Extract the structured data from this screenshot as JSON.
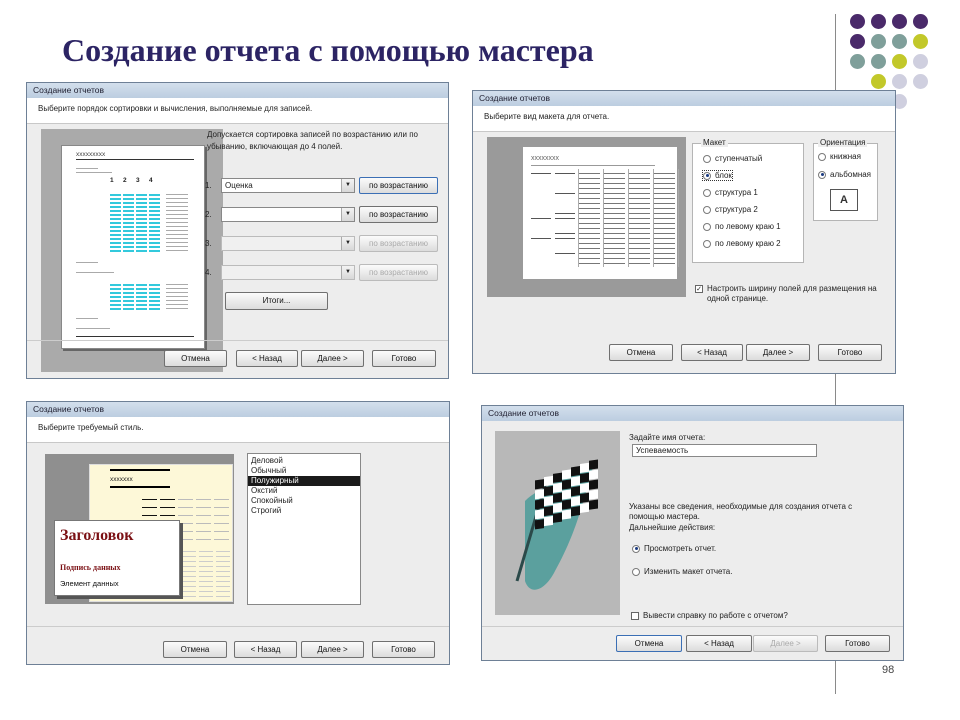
{
  "slide": {
    "title": "Создание отчета с помощью мастера",
    "page_number": "98"
  },
  "decor": {
    "dot_colors": [
      "#4a2a6a",
      "#7f9f9a",
      "#c2c82a",
      "#cfcfdf"
    ]
  },
  "d1": {
    "title": "Создание отчетов",
    "prompt": "Выберите порядок сортировки и вычисления, выполняемые для записей.",
    "description": "Допускается сортировка записей по возрастанию или по убыванию, включающая до 4 полей.",
    "preview_title": "xxxxxxxxx",
    "col_nums": [
      "1",
      "2",
      "3",
      "4"
    ],
    "sorts": [
      {
        "num": "1.",
        "value": "Оценка",
        "order": "по возрастанию"
      },
      {
        "num": "2.",
        "value": "",
        "order": "по возрастанию"
      },
      {
        "num": "3.",
        "value": "",
        "order": "по возрастанию"
      },
      {
        "num": "4.",
        "value": "",
        "order": "по возрастанию"
      }
    ],
    "totals_button": "Итоги...",
    "buttons": {
      "cancel": "Отмена",
      "back": "< Назад",
      "next": "Далее >",
      "finish": "Готово"
    }
  },
  "d2": {
    "title": "Создание отчетов",
    "prompt": "Выберите вид макета для отчета.",
    "preview_title": "xxxxxxxx",
    "layout_group": "Макет",
    "layouts": [
      "ступенчатый",
      "блок",
      "структура 1",
      "структура 2",
      "по левому краю 1",
      "по левому краю 2"
    ],
    "layout_selected": "блок",
    "orientation_group": "Ориентация",
    "orientations": [
      "книжная",
      "альбомная"
    ],
    "orientation_selected": "альбомная",
    "fit_checkbox": "Настроить ширину полей для размещения на одной странице.",
    "fit_checked": true,
    "buttons": {
      "cancel": "Отмена",
      "back": "< Назад",
      "next": "Далее >",
      "finish": "Готово"
    }
  },
  "d3": {
    "title": "Создание отчетов",
    "prompt": "Выберите требуемый стиль.",
    "styles": [
      "Деловой",
      "Обычный",
      "Полужирный",
      "Окстий",
      "Спокойный",
      "Строгий"
    ],
    "style_selected": "Полужирный",
    "preview_title": "xxxxxxx",
    "sample_heading": "Заголовок",
    "sample_label": "Подпись данных",
    "sample_element": "Элемент данных",
    "buttons": {
      "cancel": "Отмена",
      "back": "< Назад",
      "next": "Далее >",
      "finish": "Готово"
    }
  },
  "d4": {
    "title": "Создание отчетов",
    "name_label": "Задайте имя отчета:",
    "name_value": "Успеваемость",
    "info": "Указаны все сведения, необходимые для создания отчета с помощью мастера.",
    "next_actions": "Дальнейшие действия:",
    "actions": [
      "Просмотреть отчет.",
      "Изменить макет отчета."
    ],
    "action_selected": "Просмотреть отчет.",
    "help_checkbox": "Вывести справку по работе с отчетом?",
    "help_checked": false,
    "buttons": {
      "cancel": "Отмена",
      "back": "< Назад",
      "next": "Далее >",
      "finish": "Готово"
    }
  }
}
